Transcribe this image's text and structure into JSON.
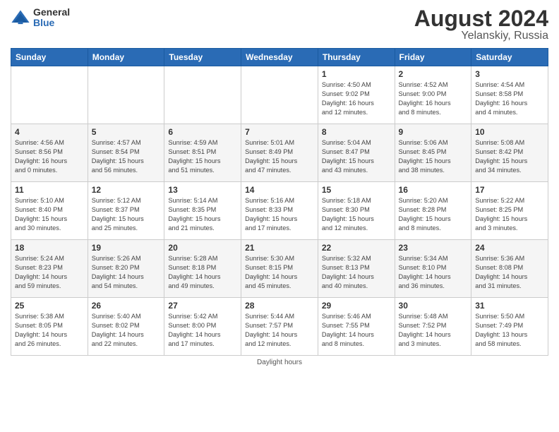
{
  "header": {
    "logo_general": "General",
    "logo_blue": "Blue",
    "month_year": "August 2024",
    "location": "Yelanskiy, Russia"
  },
  "columns": [
    "Sunday",
    "Monday",
    "Tuesday",
    "Wednesday",
    "Thursday",
    "Friday",
    "Saturday"
  ],
  "weeks": [
    [
      {
        "day": "",
        "info": ""
      },
      {
        "day": "",
        "info": ""
      },
      {
        "day": "",
        "info": ""
      },
      {
        "day": "",
        "info": ""
      },
      {
        "day": "1",
        "info": "Sunrise: 4:50 AM\nSunset: 9:02 PM\nDaylight: 16 hours\nand 12 minutes."
      },
      {
        "day": "2",
        "info": "Sunrise: 4:52 AM\nSunset: 9:00 PM\nDaylight: 16 hours\nand 8 minutes."
      },
      {
        "day": "3",
        "info": "Sunrise: 4:54 AM\nSunset: 8:58 PM\nDaylight: 16 hours\nand 4 minutes."
      }
    ],
    [
      {
        "day": "4",
        "info": "Sunrise: 4:56 AM\nSunset: 8:56 PM\nDaylight: 16 hours\nand 0 minutes."
      },
      {
        "day": "5",
        "info": "Sunrise: 4:57 AM\nSunset: 8:54 PM\nDaylight: 15 hours\nand 56 minutes."
      },
      {
        "day": "6",
        "info": "Sunrise: 4:59 AM\nSunset: 8:51 PM\nDaylight: 15 hours\nand 51 minutes."
      },
      {
        "day": "7",
        "info": "Sunrise: 5:01 AM\nSunset: 8:49 PM\nDaylight: 15 hours\nand 47 minutes."
      },
      {
        "day": "8",
        "info": "Sunrise: 5:04 AM\nSunset: 8:47 PM\nDaylight: 15 hours\nand 43 minutes."
      },
      {
        "day": "9",
        "info": "Sunrise: 5:06 AM\nSunset: 8:45 PM\nDaylight: 15 hours\nand 38 minutes."
      },
      {
        "day": "10",
        "info": "Sunrise: 5:08 AM\nSunset: 8:42 PM\nDaylight: 15 hours\nand 34 minutes."
      }
    ],
    [
      {
        "day": "11",
        "info": "Sunrise: 5:10 AM\nSunset: 8:40 PM\nDaylight: 15 hours\nand 30 minutes."
      },
      {
        "day": "12",
        "info": "Sunrise: 5:12 AM\nSunset: 8:37 PM\nDaylight: 15 hours\nand 25 minutes."
      },
      {
        "day": "13",
        "info": "Sunrise: 5:14 AM\nSunset: 8:35 PM\nDaylight: 15 hours\nand 21 minutes."
      },
      {
        "day": "14",
        "info": "Sunrise: 5:16 AM\nSunset: 8:33 PM\nDaylight: 15 hours\nand 17 minutes."
      },
      {
        "day": "15",
        "info": "Sunrise: 5:18 AM\nSunset: 8:30 PM\nDaylight: 15 hours\nand 12 minutes."
      },
      {
        "day": "16",
        "info": "Sunrise: 5:20 AM\nSunset: 8:28 PM\nDaylight: 15 hours\nand 8 minutes."
      },
      {
        "day": "17",
        "info": "Sunrise: 5:22 AM\nSunset: 8:25 PM\nDaylight: 15 hours\nand 3 minutes."
      }
    ],
    [
      {
        "day": "18",
        "info": "Sunrise: 5:24 AM\nSunset: 8:23 PM\nDaylight: 14 hours\nand 59 minutes."
      },
      {
        "day": "19",
        "info": "Sunrise: 5:26 AM\nSunset: 8:20 PM\nDaylight: 14 hours\nand 54 minutes."
      },
      {
        "day": "20",
        "info": "Sunrise: 5:28 AM\nSunset: 8:18 PM\nDaylight: 14 hours\nand 49 minutes."
      },
      {
        "day": "21",
        "info": "Sunrise: 5:30 AM\nSunset: 8:15 PM\nDaylight: 14 hours\nand 45 minutes."
      },
      {
        "day": "22",
        "info": "Sunrise: 5:32 AM\nSunset: 8:13 PM\nDaylight: 14 hours\nand 40 minutes."
      },
      {
        "day": "23",
        "info": "Sunrise: 5:34 AM\nSunset: 8:10 PM\nDaylight: 14 hours\nand 36 minutes."
      },
      {
        "day": "24",
        "info": "Sunrise: 5:36 AM\nSunset: 8:08 PM\nDaylight: 14 hours\nand 31 minutes."
      }
    ],
    [
      {
        "day": "25",
        "info": "Sunrise: 5:38 AM\nSunset: 8:05 PM\nDaylight: 14 hours\nand 26 minutes."
      },
      {
        "day": "26",
        "info": "Sunrise: 5:40 AM\nSunset: 8:02 PM\nDaylight: 14 hours\nand 22 minutes."
      },
      {
        "day": "27",
        "info": "Sunrise: 5:42 AM\nSunset: 8:00 PM\nDaylight: 14 hours\nand 17 minutes."
      },
      {
        "day": "28",
        "info": "Sunrise: 5:44 AM\nSunset: 7:57 PM\nDaylight: 14 hours\nand 12 minutes."
      },
      {
        "day": "29",
        "info": "Sunrise: 5:46 AM\nSunset: 7:55 PM\nDaylight: 14 hours\nand 8 minutes."
      },
      {
        "day": "30",
        "info": "Sunrise: 5:48 AM\nSunset: 7:52 PM\nDaylight: 14 hours\nand 3 minutes."
      },
      {
        "day": "31",
        "info": "Sunrise: 5:50 AM\nSunset: 7:49 PM\nDaylight: 13 hours\nand 58 minutes."
      }
    ]
  ],
  "footer": {
    "note": "Daylight hours"
  }
}
